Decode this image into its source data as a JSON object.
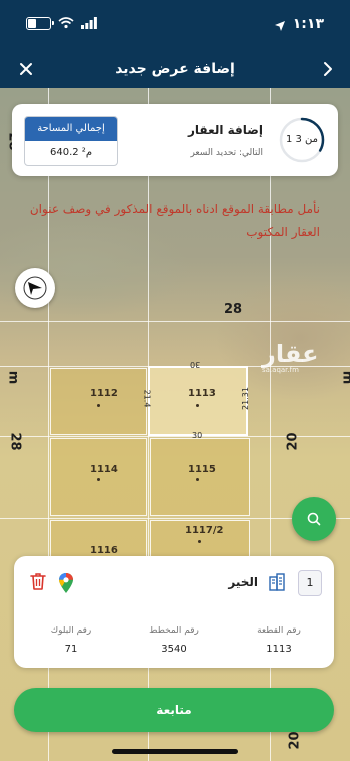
{
  "status_bar": {
    "time": "١:١٣",
    "battery_level": "١٦"
  },
  "header": {
    "title": "إضافة عرض جديد"
  },
  "step_card": {
    "step_text": "1 من 3",
    "title": "إضافة العقار",
    "next_label": "التالي: تحديد السعر",
    "area_label": "إجمالي المساحة",
    "area_value": "640.2 م²",
    "progress": 0.333
  },
  "warning": {
    "text": "نأمل مطابقة الموقع ادناه بالموقع المذكور في وصف عنوان العقار المكتوب"
  },
  "map": {
    "parcels": [
      "1112",
      "1113",
      "1114",
      "1115",
      "1117/2",
      "1116"
    ],
    "streets": [
      "28",
      "28",
      "28",
      "20",
      "20",
      "m",
      "m"
    ],
    "dimensions": [
      "30",
      "30",
      "21.4",
      "21.31"
    ],
    "watermark": "عقار",
    "watermark_sub": "sa.aqar.fm"
  },
  "property_card": {
    "index": "1",
    "district": "الخير",
    "parcel_label": "رقم القطعة",
    "parcel_value": "1113",
    "plan_label": "رقم المخطط",
    "plan_value": "3540",
    "block_label": "رقم البلوك",
    "block_value": "71"
  },
  "continue_label": "متابعة",
  "colors": {
    "primary": "#0c3657",
    "accent": "#33b35a",
    "area_header": "#2b67b1",
    "warning": "#c0392b"
  }
}
